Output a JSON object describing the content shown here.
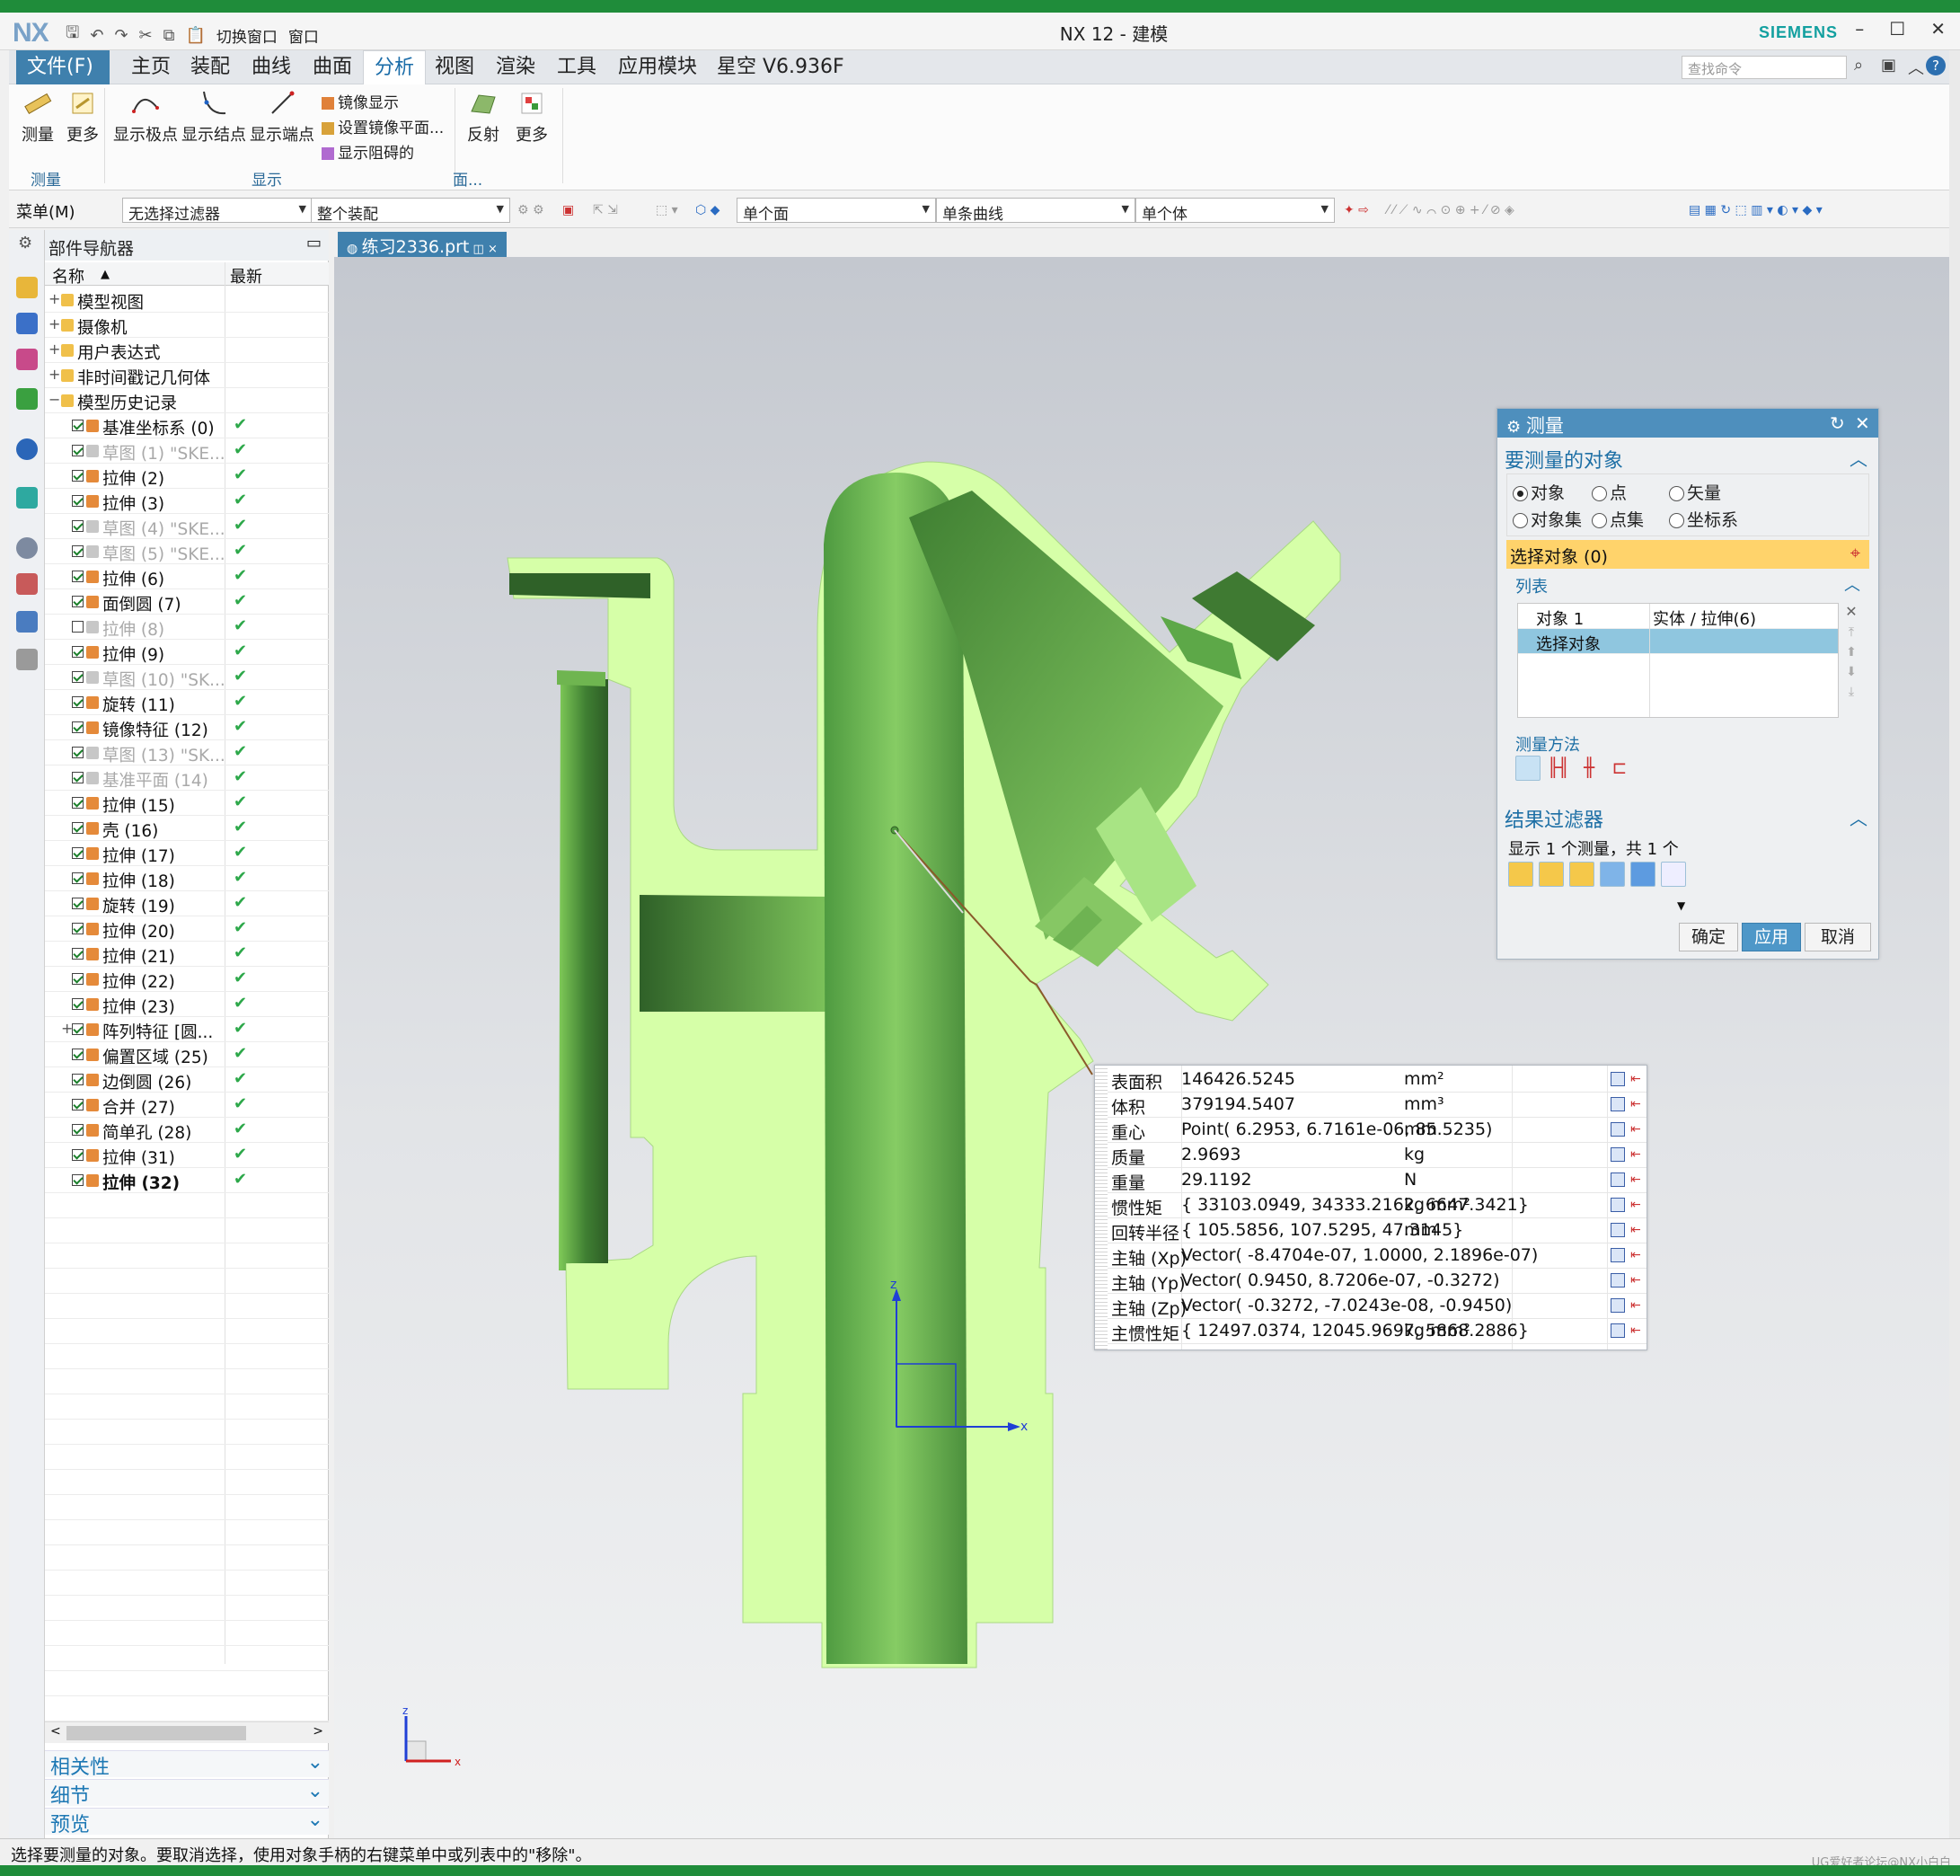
{
  "app": {
    "logo": "NX",
    "title": "NX 12 - 建模",
    "brand": "SIEMENS",
    "switch_window": "切换窗口",
    "window_menu": "窗口"
  },
  "menu": {
    "file": "文件(F)",
    "tabs": [
      "主页",
      "装配",
      "曲线",
      "曲面",
      "分析",
      "视图",
      "渲染",
      "工具",
      "应用模块",
      "星空 V6.936F"
    ],
    "active": "分析",
    "search_placeholder": "查找命令"
  },
  "ribbon": {
    "measure": "测量",
    "more": "更多",
    "group_measure": "测量",
    "show_poles": "显示极点",
    "show_knots": "显示结点",
    "show_endpoints": "显示端点",
    "mirror_display": "镜像显示",
    "set_mirror_plane": "设置镜像平面...",
    "show_obstruction": "显示阻碍的",
    "group_display": "显示",
    "reflect": "反射",
    "more2": "更多",
    "group_face": "面..."
  },
  "toolbar": {
    "menu": "菜单(M)",
    "filter": "无选择过滤器",
    "assembly": "整个装配",
    "face": "单个面",
    "curve": "单条曲线",
    "body": "单个体"
  },
  "navigator": {
    "title": "部件导航器",
    "col_name": "名称",
    "col_latest": "最新",
    "items": [
      {
        "label": "模型视图",
        "level": 0,
        "exp": "+",
        "cb": false,
        "state": ""
      },
      {
        "label": "摄像机",
        "level": 0,
        "exp": "+",
        "cb": false,
        "state": ""
      },
      {
        "label": "用户表达式",
        "level": 0,
        "exp": "+",
        "cb": false,
        "state": ""
      },
      {
        "label": "非时间戳记几何体",
        "level": 0,
        "exp": "+",
        "cb": false,
        "state": ""
      },
      {
        "label": "模型历史记录",
        "level": 0,
        "exp": "−",
        "cb": false,
        "state": ""
      },
      {
        "label": "基准坐标系 (0)",
        "level": 1,
        "exp": "",
        "cb": true,
        "state": "✔"
      },
      {
        "label": "草图 (1) \"SKE...",
        "level": 1,
        "exp": "",
        "cb": true,
        "state": "✔",
        "dim": true
      },
      {
        "label": "拉伸 (2)",
        "level": 1,
        "exp": "",
        "cb": true,
        "state": "✔"
      },
      {
        "label": "拉伸 (3)",
        "level": 1,
        "exp": "",
        "cb": true,
        "state": "✔"
      },
      {
        "label": "草图 (4) \"SKE...",
        "level": 1,
        "exp": "",
        "cb": true,
        "state": "✔",
        "dim": true
      },
      {
        "label": "草图 (5) \"SKE...",
        "level": 1,
        "exp": "",
        "cb": true,
        "state": "✔",
        "dim": true
      },
      {
        "label": "拉伸 (6)",
        "level": 1,
        "exp": "",
        "cb": true,
        "state": "✔"
      },
      {
        "label": "面倒圆 (7)",
        "level": 1,
        "exp": "",
        "cb": true,
        "state": "✔"
      },
      {
        "label": "拉伸 (8)",
        "level": 1,
        "exp": "",
        "cb": false,
        "state": "✔",
        "dim": true
      },
      {
        "label": "拉伸 (9)",
        "level": 1,
        "exp": "",
        "cb": true,
        "state": "✔"
      },
      {
        "label": "草图 (10) \"SK...",
        "level": 1,
        "exp": "",
        "cb": true,
        "state": "✔",
        "dim": true
      },
      {
        "label": "旋转 (11)",
        "level": 1,
        "exp": "",
        "cb": true,
        "state": "✔"
      },
      {
        "label": "镜像特征 (12)",
        "level": 1,
        "exp": "",
        "cb": true,
        "state": "✔"
      },
      {
        "label": "草图 (13) \"SK...",
        "level": 1,
        "exp": "",
        "cb": true,
        "state": "✔",
        "dim": true
      },
      {
        "label": "基准平面 (14)",
        "level": 1,
        "exp": "",
        "cb": true,
        "state": "✔",
        "dim": true
      },
      {
        "label": "拉伸 (15)",
        "level": 1,
        "exp": "",
        "cb": true,
        "state": "✔"
      },
      {
        "label": "壳 (16)",
        "level": 1,
        "exp": "",
        "cb": true,
        "state": "✔"
      },
      {
        "label": "拉伸 (17)",
        "level": 1,
        "exp": "",
        "cb": true,
        "state": "✔"
      },
      {
        "label": "拉伸 (18)",
        "level": 1,
        "exp": "",
        "cb": true,
        "state": "✔"
      },
      {
        "label": "旋转 (19)",
        "level": 1,
        "exp": "",
        "cb": true,
        "state": "✔"
      },
      {
        "label": "拉伸 (20)",
        "level": 1,
        "exp": "",
        "cb": true,
        "state": "✔"
      },
      {
        "label": "拉伸 (21)",
        "level": 1,
        "exp": "",
        "cb": true,
        "state": "✔"
      },
      {
        "label": "拉伸 (22)",
        "level": 1,
        "exp": "",
        "cb": true,
        "state": "✔"
      },
      {
        "label": "拉伸 (23)",
        "level": 1,
        "exp": "",
        "cb": true,
        "state": "✔"
      },
      {
        "label": "阵列特征 [圆...",
        "level": 1,
        "exp": "+",
        "cb": true,
        "state": "✔"
      },
      {
        "label": "偏置区域 (25)",
        "level": 1,
        "exp": "",
        "cb": true,
        "state": "✔"
      },
      {
        "label": "边倒圆 (26)",
        "level": 1,
        "exp": "",
        "cb": true,
        "state": "✔"
      },
      {
        "label": "合并 (27)",
        "level": 1,
        "exp": "",
        "cb": true,
        "state": "✔"
      },
      {
        "label": "简单孔 (28)",
        "level": 1,
        "exp": "",
        "cb": true,
        "state": "✔"
      },
      {
        "label": "拉伸 (31)",
        "level": 1,
        "exp": "",
        "cb": true,
        "state": "✔"
      },
      {
        "label": "拉伸 (32)",
        "level": 1,
        "exp": "",
        "cb": true,
        "state": "✔",
        "bold": true
      }
    ],
    "sections": [
      "相关性",
      "细节",
      "预览"
    ]
  },
  "document": {
    "tab": "练习2336.prt"
  },
  "measure_dialog": {
    "title": "测量",
    "section_objects": "要测量的对象",
    "types": [
      "对象",
      "点",
      "矢量",
      "对象集",
      "点集",
      "坐标系"
    ],
    "select_object": "选择对象 (0)",
    "list_label": "列表",
    "list_rows": [
      [
        "对象 1",
        "实体 / 拉伸(6)"
      ],
      [
        "选择对象",
        ""
      ]
    ],
    "method_label": "测量方法",
    "result_filter": "结果过滤器",
    "shown": "显示 1 个测量，共 1 个",
    "ok": "确定",
    "apply": "应用",
    "cancel": "取消"
  },
  "results": [
    [
      "表面积",
      "146426.5245",
      "mm²"
    ],
    [
      "体积",
      "379194.5407",
      "mm³"
    ],
    [
      "重心",
      "Point( 6.2953, 6.7161e-06, 85.5235)",
      "mm"
    ],
    [
      "质量",
      "2.9693",
      "kg"
    ],
    [
      "重量",
      "29.1192",
      "N"
    ],
    [
      "惯性矩",
      "{ 33103.0949, 34333.2162, 6647.3421}",
      "kg·mm²"
    ],
    [
      "回转半径",
      "{ 105.5856, 107.5295, 47.3145}",
      "mm"
    ],
    [
      "主轴 (Xp)",
      "Vector( -8.4704e-07, 1.0000, 2.1896e-07)",
      ""
    ],
    [
      "主轴 (Yp)",
      "Vector( 0.9450, 8.7206e-07, -0.3272)",
      ""
    ],
    [
      "主轴 (Zp)",
      "Vector( -0.3272, -7.0243e-08, -0.9450)",
      ""
    ],
    [
      "主惯性矩",
      "{ 12497.0374, 12045.9697, 5868.2886}",
      "kg·mm²"
    ]
  ],
  "axes": {
    "x": "x",
    "z": "z"
  },
  "status": "选择要测量的对象。要取消选择，使用对象手柄的右键菜单中或列表中的\"移除\"。",
  "watermark": "UG爱好者论坛@NX小白白",
  "colors": {
    "accent": "#3f80ad",
    "solid_light": "#d6ffa8",
    "solid_dark": "#4f9a3c",
    "highlight": "#ffd36b"
  }
}
